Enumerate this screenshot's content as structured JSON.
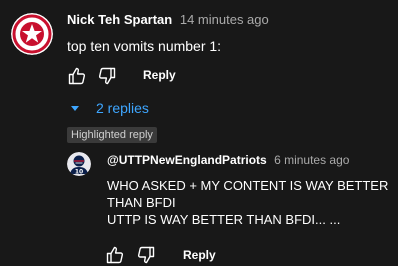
{
  "comment": {
    "author": "Nick Teh Spartan",
    "time": "14 minutes ago",
    "text": "top ten vomits number 1:",
    "reply_label": "Reply",
    "avatar_icon": "red-star-emblem",
    "avatar_colors": {
      "background": "#ffffff",
      "ring": "#c8102e",
      "star": "#c8102e"
    }
  },
  "replies_toggle": {
    "label": "2 replies",
    "icon": "caret-down-icon",
    "color": "#3ea6ff"
  },
  "highlighted_reply": {
    "badge": "Highlighted reply",
    "author": "@UTTPNewEnglandPatriots",
    "time": "6 minutes ago",
    "text_lines": [
      "WHO ASKED + MY CONTENT IS WAY BETTER",
      "THAN BFDI",
      "UTTP IS WAY BETTER THAN BFDI... ..."
    ],
    "reply_label": "Reply",
    "avatar_icon": "football-player-jersey-10"
  },
  "colors": {
    "background": "#181818",
    "text": "#ffffff",
    "muted": "#aaaaaa",
    "link": "#3ea6ff"
  }
}
